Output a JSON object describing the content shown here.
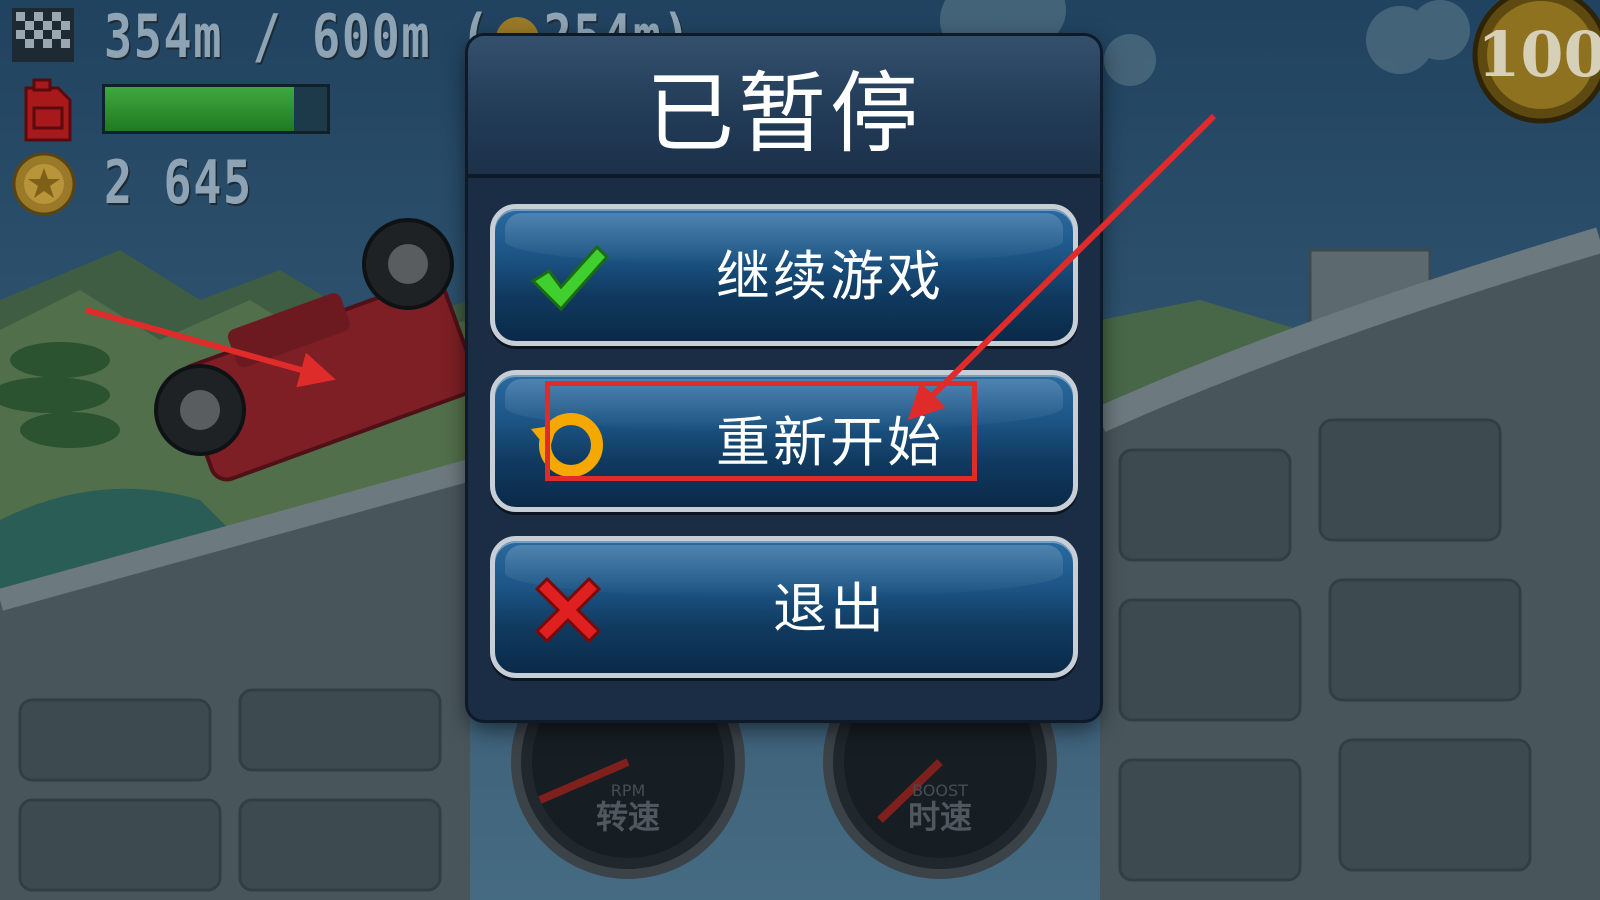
{
  "hud": {
    "distance_text": "354m / 600m (",
    "distance_partial": "254m)",
    "fuel_level": 0.85,
    "coins_text": "2 645",
    "badge_text": "100",
    "icons": [
      "checkered-flag-icon",
      "fuel-can-icon",
      "coin-icon",
      "coin-badge-icon"
    ]
  },
  "dialog": {
    "title": "已暂停",
    "buttons": [
      {
        "label": "继续游戏",
        "icon": "green-check-icon"
      },
      {
        "label": "重新开始",
        "icon": "restart-arrow-icon"
      },
      {
        "label": "退出",
        "icon": "red-x-icon"
      }
    ]
  },
  "gauges": {
    "rpm": {
      "label_en": "RPM",
      "label_cn": "转速"
    },
    "boost": {
      "label_en": "BOOST",
      "label_cn": "时速"
    }
  },
  "colors": {
    "annotation": "#e02b2b",
    "fuel": "#3fa83f",
    "button": "#1c5585",
    "check": "#3fcf2f",
    "cross": "#e02020",
    "restart": "#f5a800"
  }
}
